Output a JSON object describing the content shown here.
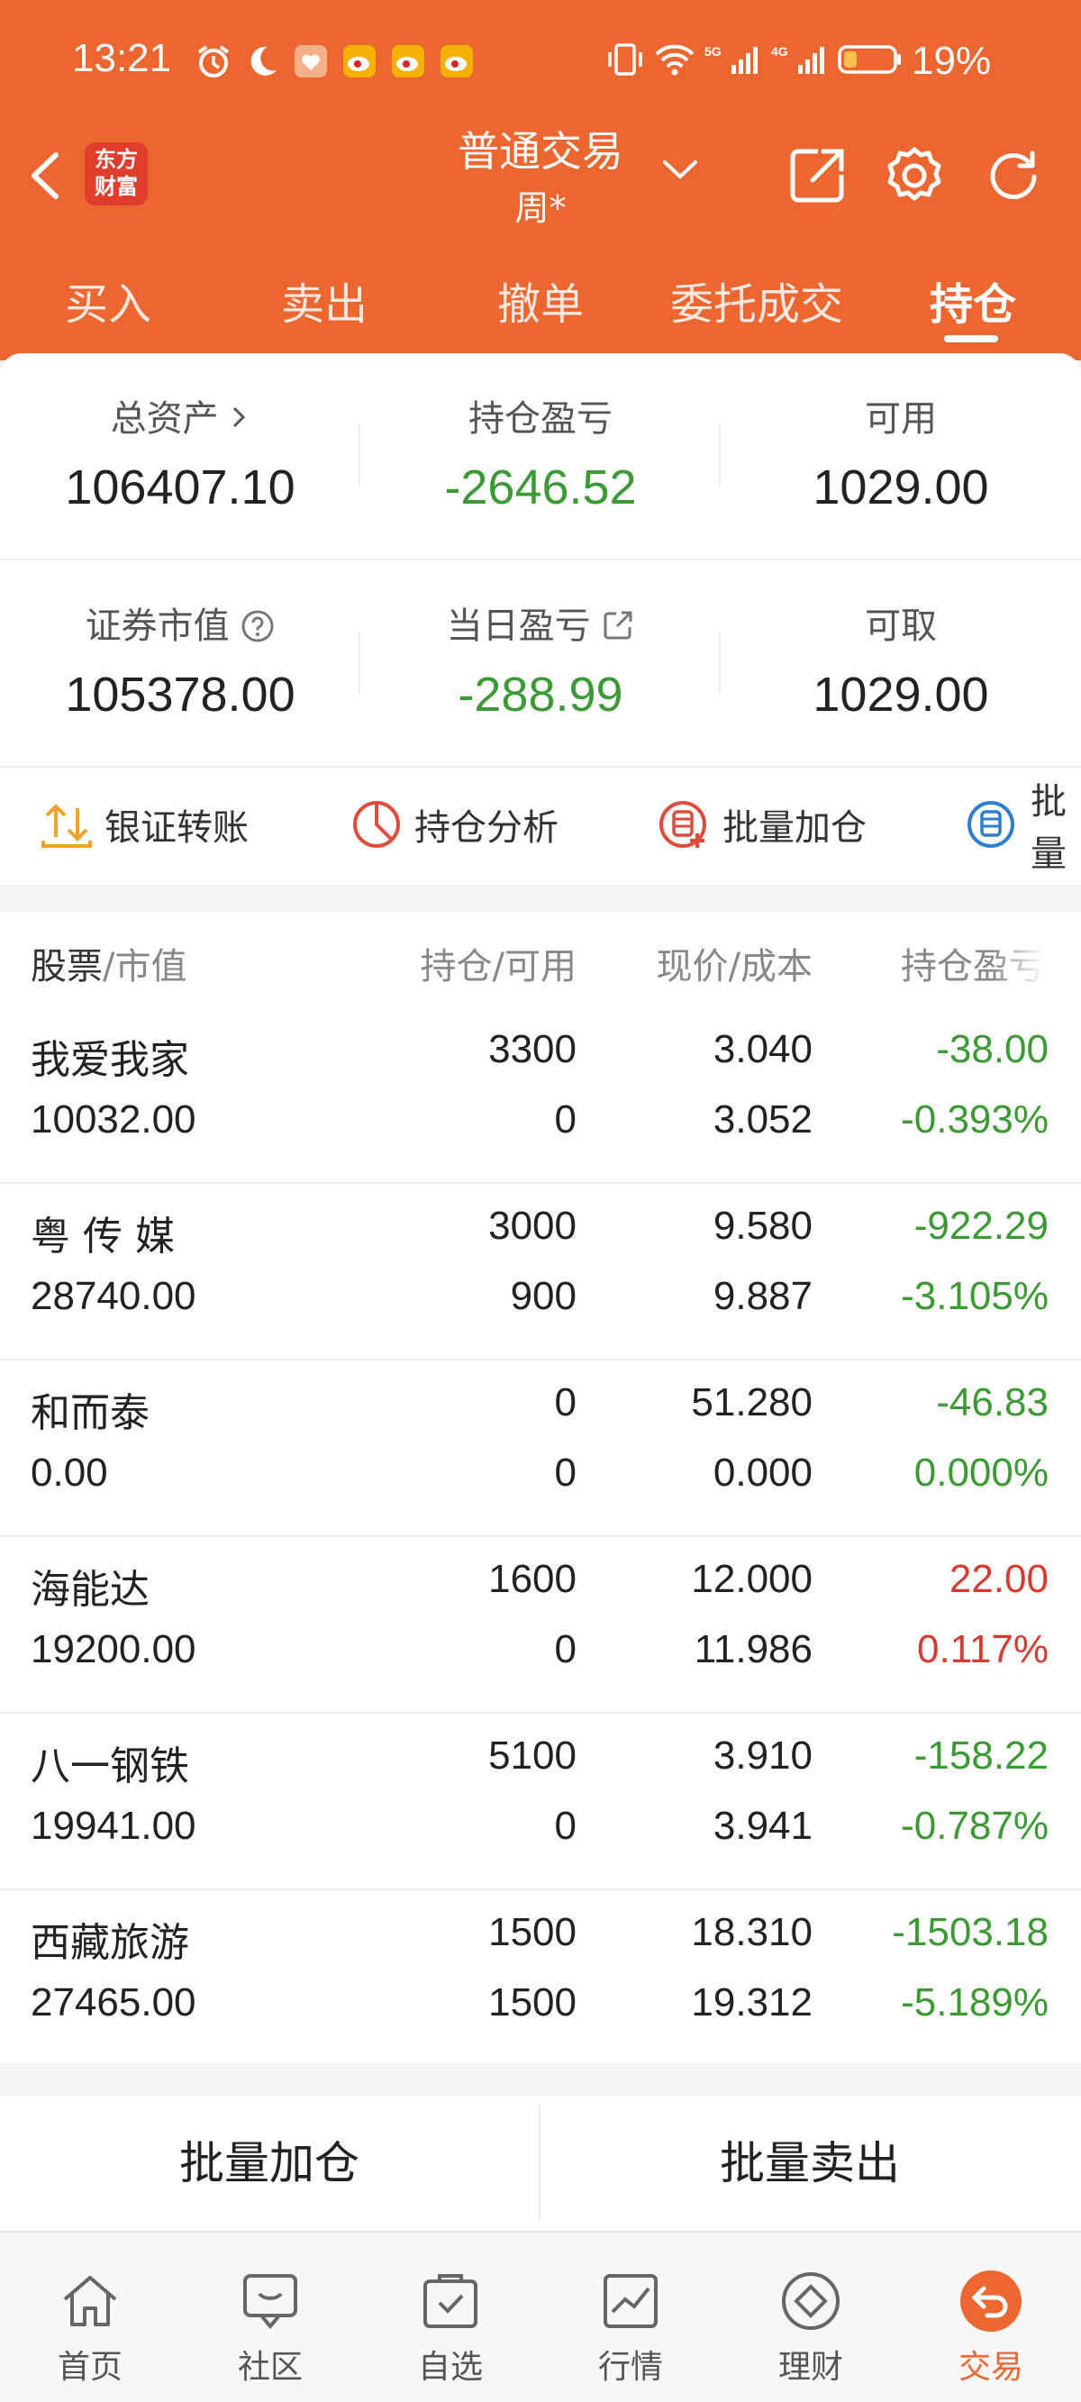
{
  "status_bar": {
    "time": "13:21",
    "battery_pct": "19%"
  },
  "header": {
    "logo_text": "东方财富",
    "account_title": "普通交易",
    "account_sub": "周*",
    "tabs": [
      "买入",
      "卖出",
      "撤单",
      "委托成交",
      "持仓"
    ],
    "active_tab": "持仓"
  },
  "summary": {
    "total_assets_label": "总资产",
    "total_assets": "106407.10",
    "position_pl_label": "持仓盈亏",
    "position_pl": "-2646.52",
    "available_label": "可用",
    "available": "1029.00",
    "market_value_label": "证券市值",
    "market_value": "105378.00",
    "daily_pl_label": "当日盈亏",
    "daily_pl": "-288.99",
    "withdrawable_label": "可取",
    "withdrawable": "1029.00"
  },
  "quick_actions": [
    "银证转账",
    "持仓分析",
    "批量加仓",
    "批量"
  ],
  "table": {
    "headers": {
      "stock": "股票",
      "market_value": "/市值",
      "holding": "持仓/可用",
      "price": "现价/成本",
      "pl": "持仓盈亏"
    },
    "rows": [
      {
        "name": "我爱我家",
        "value": "10032.00",
        "holding": "3300",
        "avail": "0",
        "price": "3.040",
        "cost": "3.052",
        "pl": "-38.00",
        "pl_pct": "-0.393%",
        "sign": "neg"
      },
      {
        "name": "粤 传 媒",
        "value": "28740.00",
        "holding": "3000",
        "avail": "900",
        "price": "9.580",
        "cost": "9.887",
        "pl": "-922.29",
        "pl_pct": "-3.105%",
        "sign": "neg"
      },
      {
        "name": "和而泰",
        "value": "0.00",
        "holding": "0",
        "avail": "0",
        "price": "51.280",
        "cost": "0.000",
        "pl": "-46.83",
        "pl_pct": "0.000%",
        "sign": "neg"
      },
      {
        "name": "海能达",
        "value": "19200.00",
        "holding": "1600",
        "avail": "0",
        "price": "12.000",
        "cost": "11.986",
        "pl": "22.00",
        "pl_pct": "0.117%",
        "sign": "pos"
      },
      {
        "name": "八一钢铁",
        "value": "19941.00",
        "holding": "5100",
        "avail": "0",
        "price": "3.910",
        "cost": "3.941",
        "pl": "-158.22",
        "pl_pct": "-0.787%",
        "sign": "neg"
      },
      {
        "name": "西藏旅游",
        "value": "27465.00",
        "holding": "1500",
        "avail": "1500",
        "price": "18.310",
        "cost": "19.312",
        "pl": "-1503.18",
        "pl_pct": "-5.189%",
        "sign": "neg"
      }
    ]
  },
  "batch": {
    "add_label": "批量加仓",
    "sell_label": "批量卖出"
  },
  "nav": [
    "首页",
    "社区",
    "自选",
    "行情",
    "理财",
    "交易"
  ],
  "colors": {
    "brand": "#ec6630",
    "gain": "#d43c32",
    "loss": "#3b9a34"
  }
}
